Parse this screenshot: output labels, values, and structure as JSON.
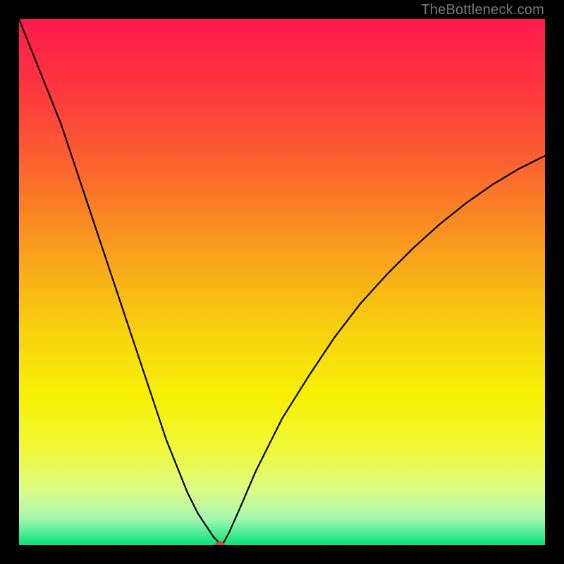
{
  "watermark": "TheBottleneck.com",
  "chart_data": {
    "type": "line",
    "title": "",
    "xlabel": "",
    "ylabel": "",
    "xlim": [
      0,
      100
    ],
    "ylim": [
      0,
      100
    ],
    "grid": false,
    "legend": false,
    "background_gradient": {
      "stops": [
        {
          "pos": 0.0,
          "color": "#ff1a4b"
        },
        {
          "pos": 0.15,
          "color": "#fd3b3d"
        },
        {
          "pos": 0.3,
          "color": "#fb6b2c"
        },
        {
          "pos": 0.45,
          "color": "#f9a21c"
        },
        {
          "pos": 0.6,
          "color": "#f8d40e"
        },
        {
          "pos": 0.72,
          "color": "#f7f106"
        },
        {
          "pos": 0.82,
          "color": "#f1f83a"
        },
        {
          "pos": 0.9,
          "color": "#d9fb8a"
        },
        {
          "pos": 0.95,
          "color": "#a5f8b0"
        },
        {
          "pos": 0.985,
          "color": "#37e98d"
        },
        {
          "pos": 1.0,
          "color": "#00e57c"
        }
      ]
    },
    "series": [
      {
        "name": "bottleneck-curve",
        "color": "#000000",
        "width": 2.2,
        "x": [
          0,
          2,
          4,
          6,
          8,
          10,
          12,
          14,
          16,
          18,
          20,
          22,
          24,
          26,
          28,
          30,
          32,
          34,
          36,
          37,
          37.9,
          38.5,
          39,
          40,
          42,
          45,
          50,
          55,
          60,
          65,
          70,
          75,
          80,
          85,
          90,
          95,
          100
        ],
        "y": [
          100,
          95,
          90,
          85,
          80,
          74,
          68,
          62,
          56,
          50,
          44,
          38,
          32,
          26,
          20,
          15,
          10,
          6,
          3,
          1.5,
          0.6,
          0.2,
          0.6,
          2.5,
          7,
          14,
          24,
          32,
          39.5,
          46,
          51.5,
          56.5,
          61,
          65,
          68.5,
          71.5,
          74
        ]
      }
    ],
    "marker": {
      "name": "optimal-point",
      "x": 38.2,
      "y": 0.0,
      "color": "#d24a3a",
      "rx": 7,
      "ry": 5
    }
  }
}
